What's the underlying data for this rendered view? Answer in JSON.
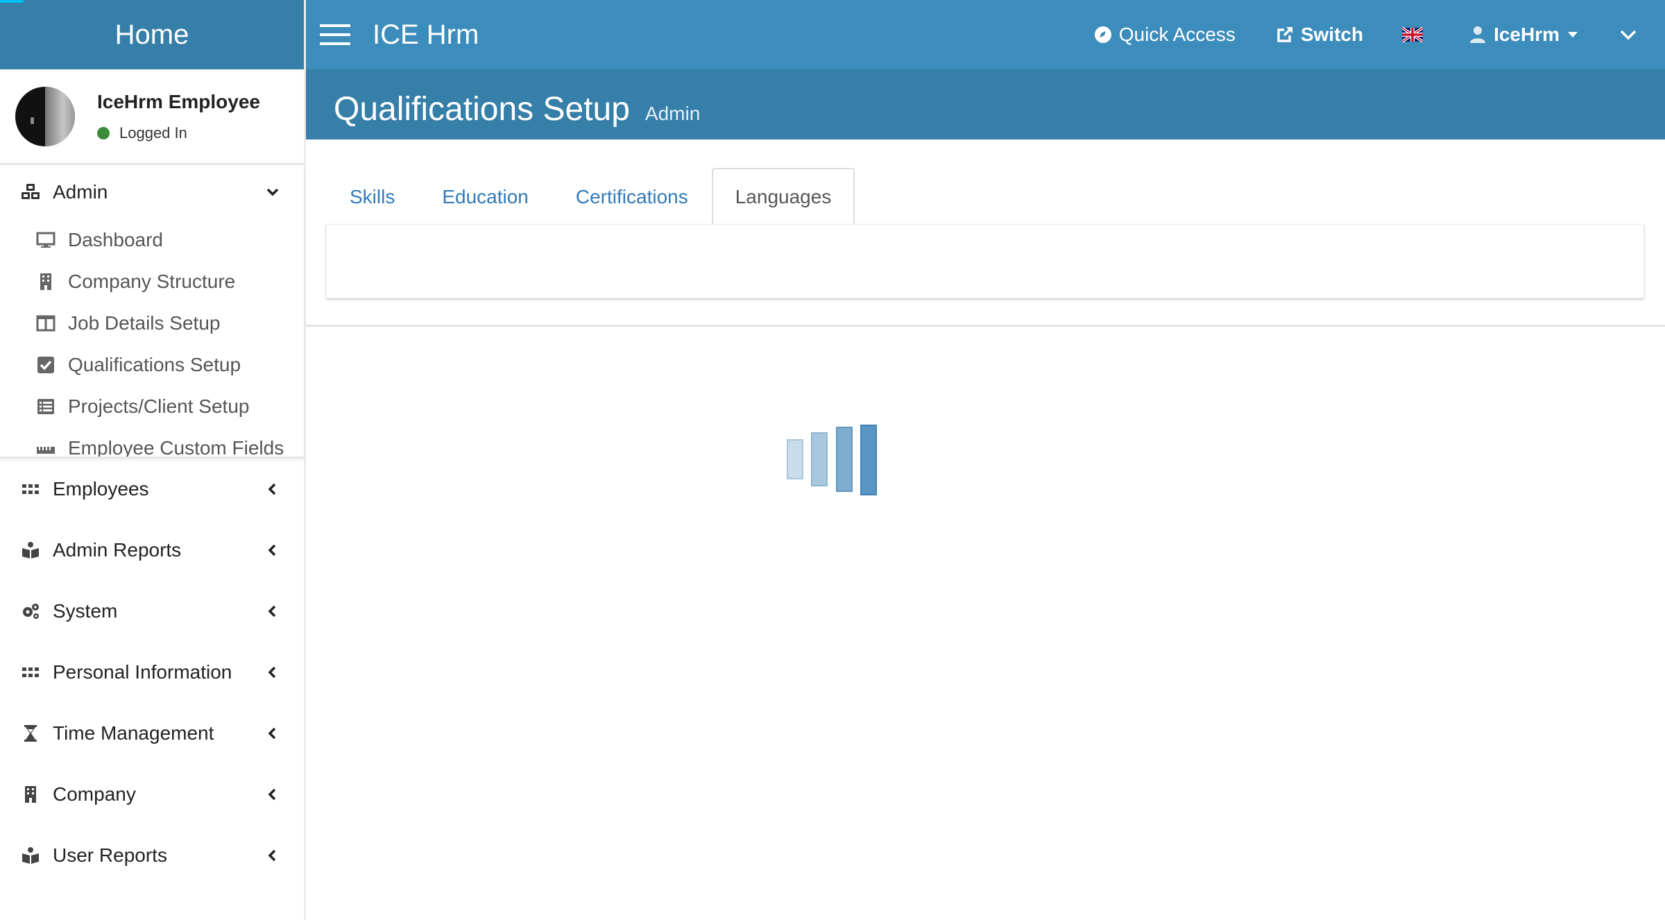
{
  "sidebar": {
    "brand": "Home",
    "user": {
      "name": "IceHrm Employee",
      "status": "Logged In"
    },
    "admin": {
      "label": "Admin",
      "items": [
        {
          "label": "Dashboard",
          "icon": "monitor-icon"
        },
        {
          "label": "Company Structure",
          "icon": "building-icon"
        },
        {
          "label": "Job Details Setup",
          "icon": "columns-icon"
        },
        {
          "label": "Qualifications Setup",
          "icon": "check-square-icon"
        },
        {
          "label": "Projects/Client Setup",
          "icon": "list-icon"
        },
        {
          "label": "Employee Custom Fields",
          "icon": "ruler-icon"
        }
      ]
    },
    "menus": [
      {
        "label": "Employees",
        "icon": "grid-icon"
      },
      {
        "label": "Admin Reports",
        "icon": "book-icon"
      },
      {
        "label": "System",
        "icon": "gears-icon"
      },
      {
        "label": "Personal Information",
        "icon": "grid-icon"
      },
      {
        "label": "Time Management",
        "icon": "hourglass-icon"
      },
      {
        "label": "Company",
        "icon": "building-icon"
      },
      {
        "label": "User Reports",
        "icon": "book-icon"
      }
    ]
  },
  "topbar": {
    "app_title": "ICE Hrm",
    "quick_access": "Quick Access",
    "switch": "Switch",
    "user_menu": "IceHrm",
    "language_icon": "uk-flag-icon"
  },
  "page": {
    "title": "Qualifications Setup",
    "subtitle": "Admin"
  },
  "tabs": [
    {
      "label": "Skills",
      "active": false
    },
    {
      "label": "Education",
      "active": false
    },
    {
      "label": "Certifications",
      "active": false
    },
    {
      "label": "Languages",
      "active": true
    }
  ],
  "colors": {
    "topbar": "#3c8dbc",
    "header": "#367fa9",
    "link": "#337ab7",
    "status_online": "#3c8a3c"
  }
}
